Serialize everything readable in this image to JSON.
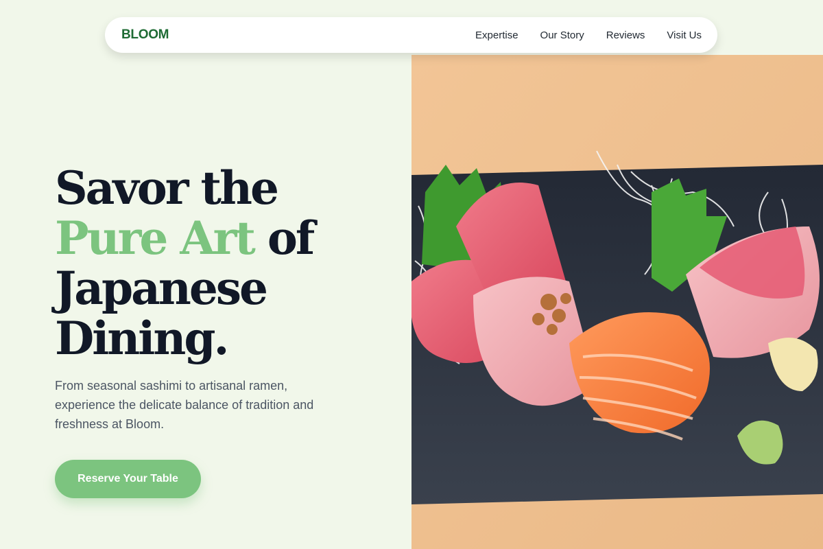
{
  "brand": {
    "name": "BLOOM"
  },
  "nav": {
    "items": [
      {
        "label": "Expertise"
      },
      {
        "label": "Our Story"
      },
      {
        "label": "Reviews"
      },
      {
        "label": "Visit Us"
      }
    ]
  },
  "hero": {
    "headline_line1": "Savor the",
    "headline_accent": "Pure Art",
    "headline_line2_rest": "of",
    "headline_line3": "Japanese",
    "headline_line4": "Dining.",
    "subtitle": "From seasonal sashimi to artisanal ramen, experience the delicate balance of tradition and freshness at Bloom.",
    "cta_label": "Reserve Your Table"
  },
  "colors": {
    "background": "#f1f7ea",
    "brand": "#1e6b34",
    "accent": "#7cc47f",
    "heading": "#111827",
    "body_text": "#4b5563"
  },
  "image": {
    "icon": "sashimi-platter-photo"
  }
}
